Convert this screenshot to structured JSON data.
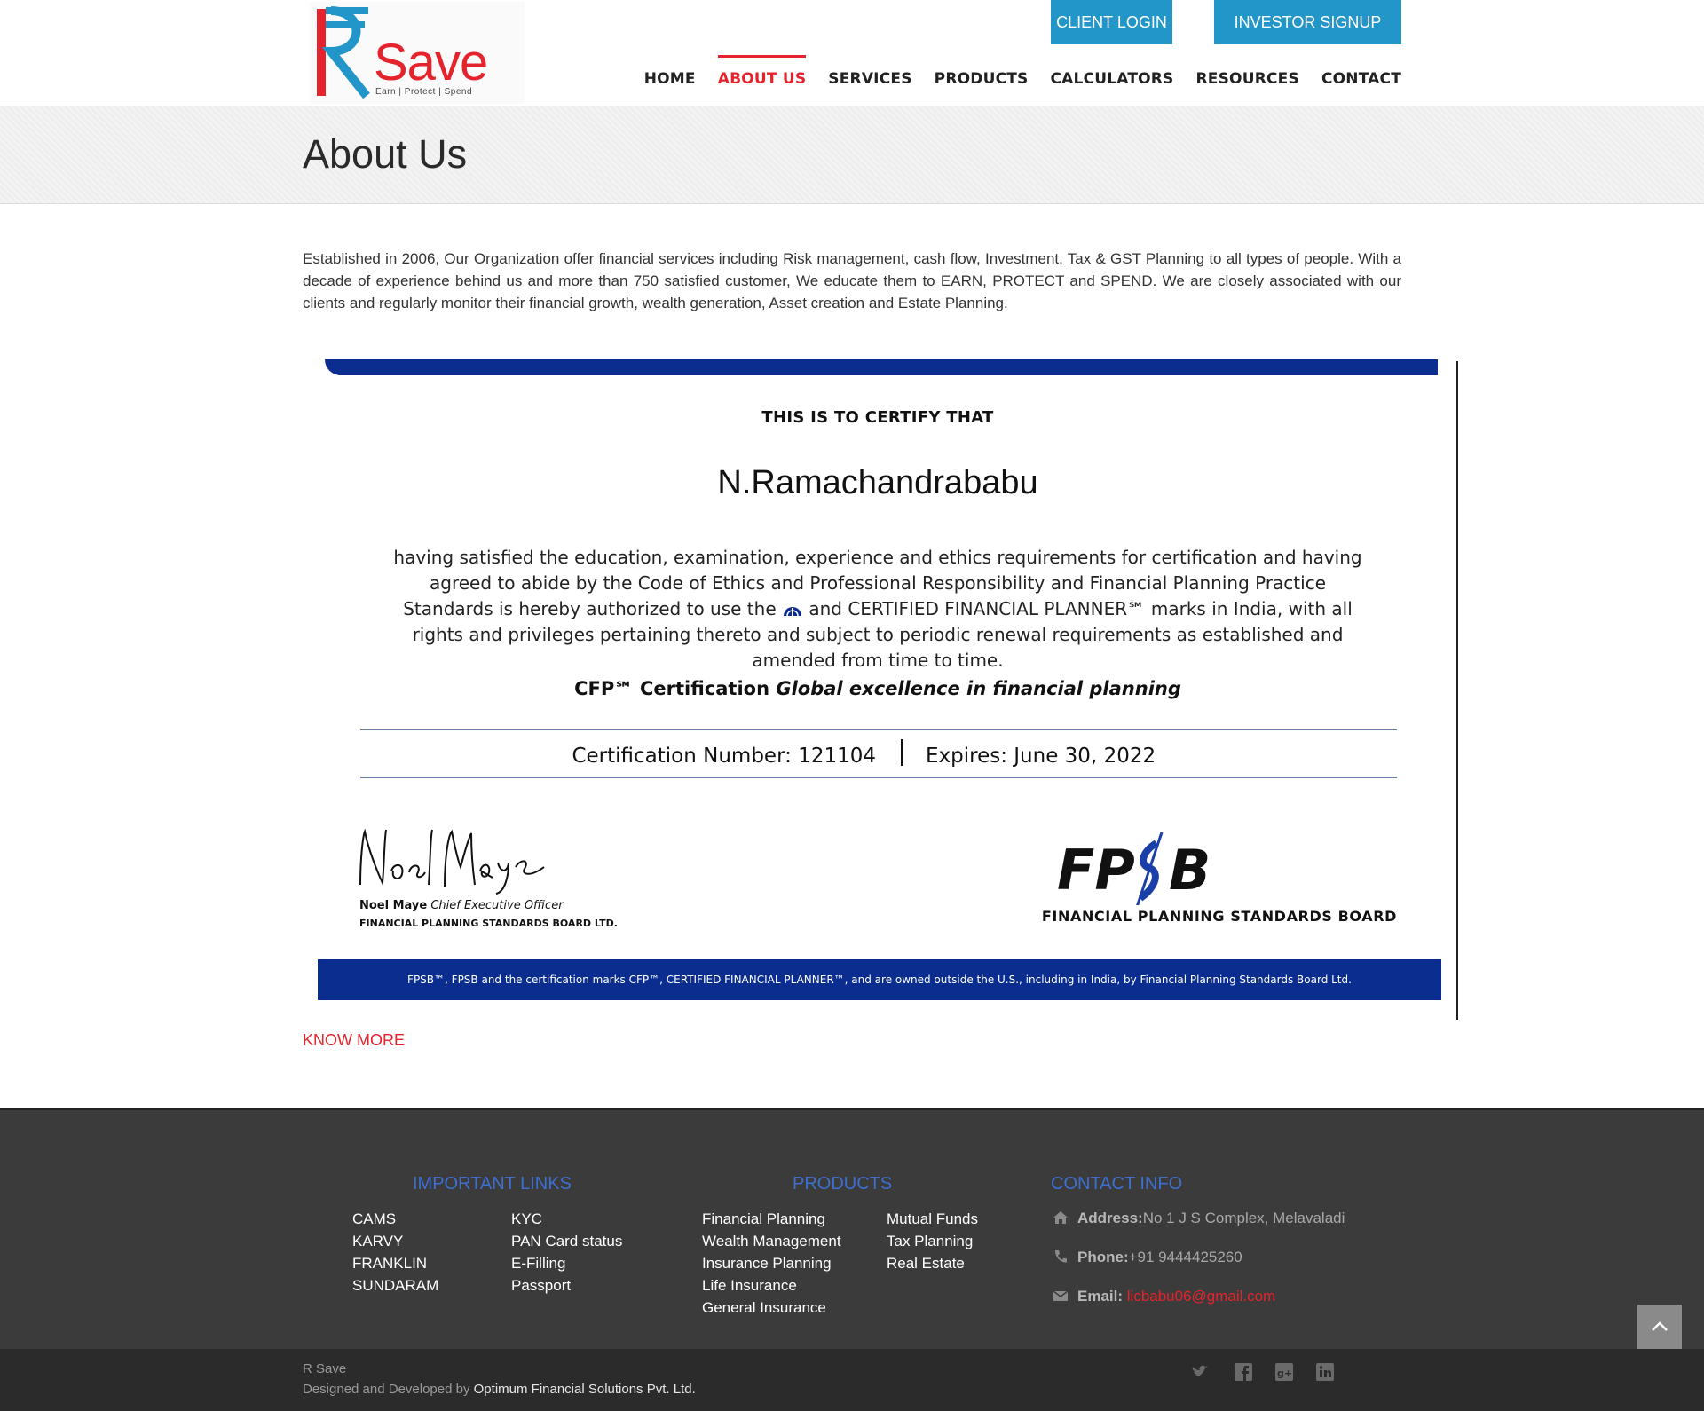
{
  "header": {
    "logo_text": "Save",
    "logo_tagline": "Earn | Protect | Spend",
    "buttons": {
      "client_login": "CLIENT LOGIN",
      "investor_signup": "INVESTOR SIGNUP"
    },
    "nav": [
      "HOME",
      "ABOUT US",
      "SERVICES",
      "PRODUCTS",
      "CALCULATORS",
      "RESOURCES",
      "CONTACT"
    ],
    "active_nav": "ABOUT US"
  },
  "page": {
    "title": "About Us",
    "intro": "Established in 2006, Our Organization offer financial services including Risk management, cash flow, Investment, Tax & GST Planning to all types of people. With a decade of experience behind us and more than 750 satisfied customer, We educate them to EARN, PROTECT and SPEND. We are closely associated with our clients and regularly monitor their financial growth, wealth generation, Asset creation and Estate Planning.",
    "know_more": "KNOW MORE"
  },
  "certificate": {
    "heading": "THIS IS TO CERTIFY THAT",
    "name": "N.Ramachandrababu",
    "body_1": "having satisfied the education, examination, experience and ethics requirements for certification and having agreed to abide by the Code of Ethics and Professional Responsibility and Financial Planning Practice Standards is hereby authorized to use the",
    "body_2": "and CERTIFIED FINANCIAL PLANNER℠ marks in India, with all rights and privileges pertaining thereto and subject to periodic renewal requirements as established and amended from time to time.",
    "tagline_plain": "CFP℠ Certification",
    "tagline_italic": "Global excellence in financial planning",
    "number": "Certification Number: 121104",
    "expires": "Expires: June 30, 2022",
    "signer_name": "Noel Maye",
    "signer_title": "Chief Executive Officer",
    "signer_org": "FINANCIAL PLANNING STANDARDS BOARD LTD.",
    "board_logo": "FPSB",
    "board_name": "FINANCIAL PLANNING STANDARDS BOARD",
    "footer_note": "FPSB™, FPSB and the certification marks CFP™, CERTIFIED FINANCIAL PLANNER™, and  are owned outside the U.S., including in India, by Financial Planning Standards Board Ltd."
  },
  "footer": {
    "important_links_title": "IMPORTANT LINKS",
    "links_col1": [
      "CAMS",
      "KARVY",
      "FRANKLIN",
      "SUNDARAM"
    ],
    "links_col2": [
      "KYC",
      "PAN Card status",
      "E-Filling",
      "Passport"
    ],
    "products_title": "PRODUCTS",
    "products_col1": [
      "Financial Planning",
      "Wealth Management",
      "Insurance Planning",
      "Life Insurance",
      "General Insurance"
    ],
    "products_col2": [
      "Mutual Funds",
      "Tax Planning",
      "Real Estate"
    ],
    "contact_title": "CONTACT INFO",
    "address_label": "Address:",
    "address": "No 1 J S Complex, Melavaladi",
    "phone_label": "Phone:",
    "phone": "+91 9444425260",
    "email_label": "Email:",
    "email": "licbabu06@gmail.com"
  },
  "bottom": {
    "brand": "R Save",
    "credit_prefix": "Designed and Developed by ",
    "credit_company": "Optimum Financial Solutions Pvt. Ltd."
  },
  "colors": {
    "brand_red": "#e4232d",
    "brand_blue": "#2396c9",
    "cert_blue": "#0b2d8f",
    "footer_heading": "#3d6fd0"
  },
  "icons": [
    "home-icon",
    "phone-icon",
    "mail-icon",
    "twitter-icon",
    "facebook-icon",
    "google-plus-icon",
    "linkedin-icon",
    "chevron-up-icon"
  ]
}
